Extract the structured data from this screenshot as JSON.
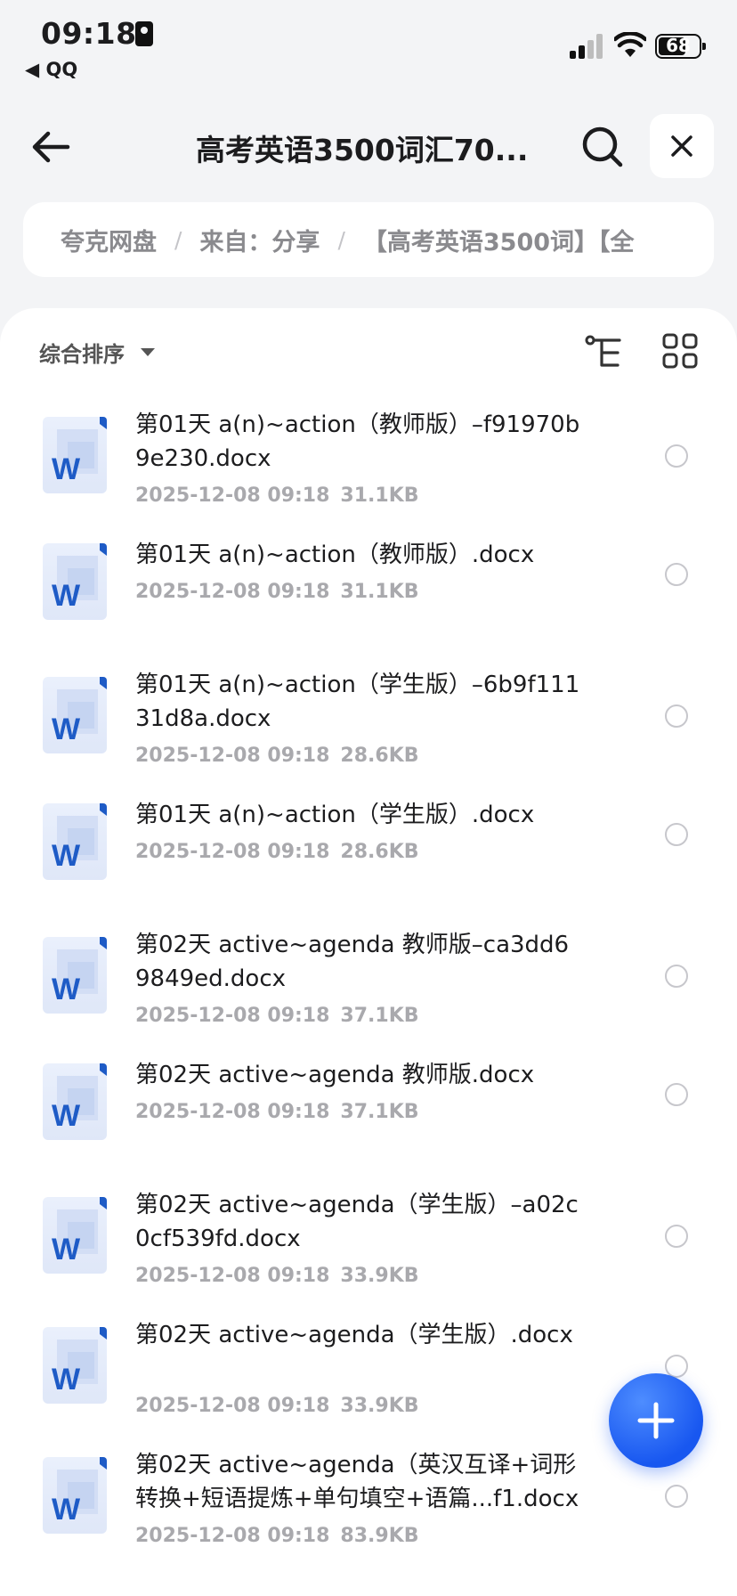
{
  "status_bar": {
    "time": "09:18",
    "back_app": "◀ QQ",
    "battery": "68"
  },
  "header": {
    "title": "高考英语3500词汇70..."
  },
  "breadcrumb": {
    "items": [
      "夸克网盘",
      "来自：分享",
      "【高考英语3500词】【全"
    ]
  },
  "toolbar": {
    "sort_label": "综合排序"
  },
  "colors": {
    "accent": "#1857f0",
    "word_blue": "#1e5bc6",
    "meta_gray": "#a9a9ad"
  },
  "files": [
    {
      "name": "第01天 a(n)~action（教师版）–f91970b9e230.docx",
      "date": "2025-12-08 09:18",
      "size": "31.1KB"
    },
    {
      "name": "第01天 a(n)~action（教师版）.docx",
      "date": "2025-12-08 09:18",
      "size": "31.1KB"
    },
    {
      "name": "第01天 a(n)~action（学生版）–6b9f11131d8a.docx",
      "date": "2025-12-08 09:18",
      "size": "28.6KB"
    },
    {
      "name": "第01天 a(n)~action（学生版）.docx",
      "date": "2025-12-08 09:18",
      "size": "28.6KB"
    },
    {
      "name": "第02天 active~agenda 教师版–ca3dd69849ed.docx",
      "date": "2025-12-08 09:18",
      "size": "37.1KB"
    },
    {
      "name": "第02天 active~agenda 教师版.docx",
      "date": "2025-12-08 09:18",
      "size": "37.1KB"
    },
    {
      "name": "第02天 active~agenda（学生版）–a02c0cf539fd.docx",
      "date": "2025-12-08 09:18",
      "size": "33.9KB"
    },
    {
      "name": "第02天 active~agenda（学生版）.docx",
      "date": "2025-12-08 09:18",
      "size": "33.9KB"
    },
    {
      "name": "第02天 active~agenda（英汉互译+词形转换+短语提炼+单句填空+语篇...f1.docx",
      "date": "2025-12-08 09:18",
      "size": "83.9KB"
    }
  ]
}
